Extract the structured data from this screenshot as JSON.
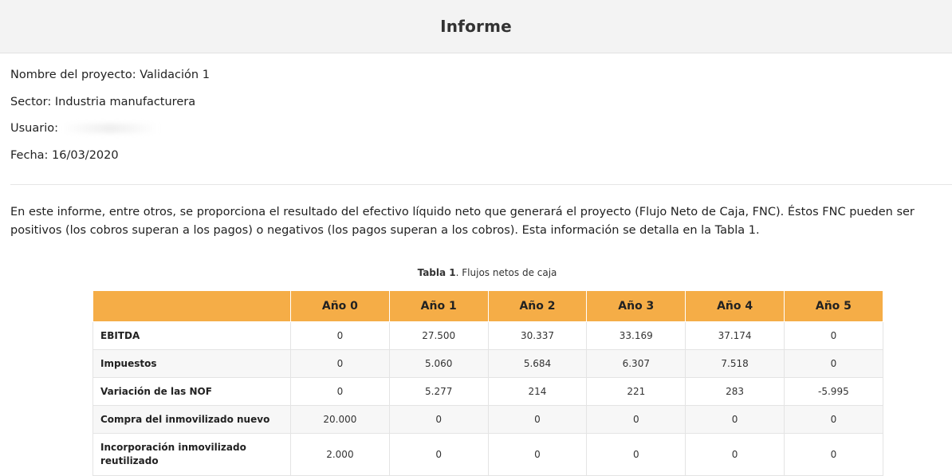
{
  "header": {
    "title": "Informe"
  },
  "meta": {
    "project_label": "Nombre del proyecto:",
    "project_value": "Validación 1",
    "sector_label": "Sector:",
    "sector_value": "Industria manufacturera",
    "user_label": "Usuario:",
    "date_label": "Fecha:",
    "date_value": "16/03/2020"
  },
  "intro": {
    "text": "En este informe, entre otros, se proporciona el resultado del efectivo líquido neto que generará el proyecto (Flujo Neto de Caja, FNC). Éstos FNC pueden ser positivos (los cobros superan a los pagos) o negativos (los pagos superan a los cobros). Esta información se detalla en la Tabla 1."
  },
  "table": {
    "caption_bold": "Tabla 1",
    "caption_rest": ". Flujos netos de caja",
    "columns": [
      "",
      "Año 0",
      "Año 1",
      "Año 2",
      "Año 3",
      "Año 4",
      "Año 5"
    ],
    "rows": [
      {
        "label": "EBITDA",
        "values": [
          "0",
          "27.500",
          "30.337",
          "33.169",
          "37.174",
          "0"
        ]
      },
      {
        "label": "Impuestos",
        "values": [
          "0",
          "5.060",
          "5.684",
          "6.307",
          "7.518",
          "0"
        ]
      },
      {
        "label": "Variación de las NOF",
        "values": [
          "0",
          "5.277",
          "214",
          "221",
          "283",
          "-5.995"
        ]
      },
      {
        "label": "Compra del inmovilizado nuevo",
        "values": [
          "20.000",
          "0",
          "0",
          "0",
          "0",
          "0"
        ]
      },
      {
        "label": "Incorporación inmovilizado reutilizado",
        "values": [
          "2.000",
          "0",
          "0",
          "0",
          "0",
          "0"
        ]
      }
    ]
  }
}
